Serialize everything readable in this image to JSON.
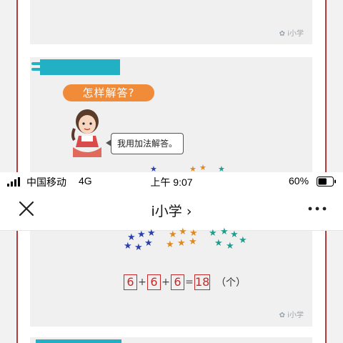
{
  "status_bar": {
    "carrier": "中国移动",
    "network": "4G",
    "time": "上午 9:07",
    "battery_percent": "60%",
    "battery_level": 0.6
  },
  "nav": {
    "title": "i小学",
    "title_chevron": "›"
  },
  "article": {
    "watermark": "i小学",
    "question_title": "怎样解答?",
    "speech_bubble": "我用加法解答。",
    "equation": {
      "operands": [
        "6",
        "6",
        "6"
      ],
      "operator": "+",
      "equals": "=",
      "result": "18",
      "unit": "（个）"
    }
  },
  "colors": {
    "teal": "#22b1c4",
    "orange": "#f08b3a",
    "red": "#c52a2a",
    "frame_red": "#b23a3a"
  }
}
